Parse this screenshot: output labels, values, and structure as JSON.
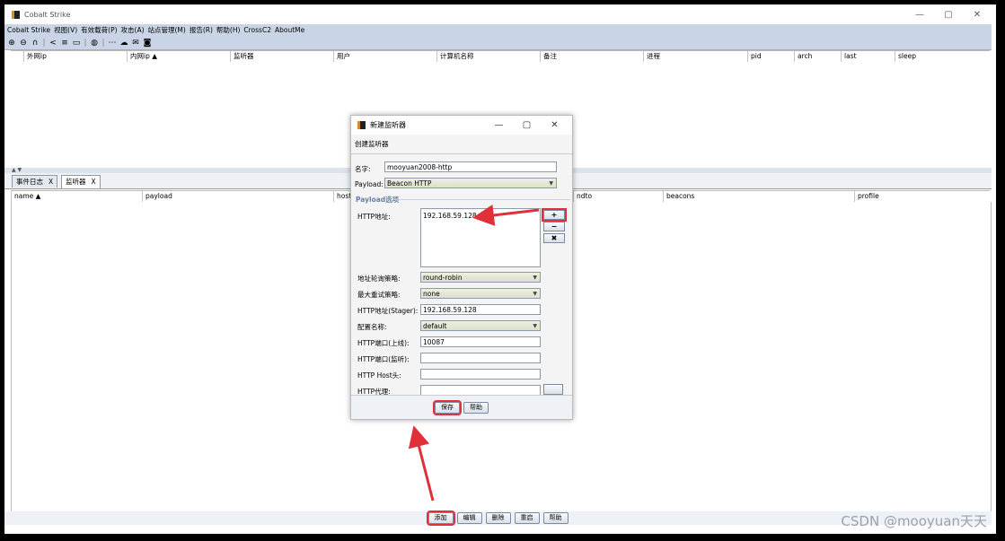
{
  "window": {
    "title": "Cobalt Strike",
    "min": "—",
    "max": "▢",
    "close": "✕"
  },
  "menu": [
    "Cobalt Strike",
    "视图(V)",
    "有效载荷(P)",
    "攻击(A)",
    "站点管理(M)",
    "报告(R)",
    "帮助(H)",
    "CrossC2",
    "AboutMe"
  ],
  "toolbar_icons": [
    "plus-circle-icon",
    "minus-circle-icon",
    "headphones-icon",
    "share-icon",
    "list-icon",
    "monitor-icon",
    "globe-icon",
    "ellipsis-icon",
    "cloud-icon",
    "mail-icon",
    "camera-icon"
  ],
  "session_table": {
    "columns": [
      "外网ip",
      "内网ip ▲",
      "监听器",
      "用户",
      "计算机名称",
      "备注",
      "进程",
      "pid",
      "arch",
      "last",
      "sleep"
    ]
  },
  "tabs": [
    {
      "label": "事件日志",
      "close": "X"
    },
    {
      "label": "监听器",
      "close": "X"
    }
  ],
  "listener_table": {
    "columns": [
      "name ▲",
      "payload",
      "host",
      "ndto",
      "beacons",
      "profile"
    ]
  },
  "bottom_buttons": [
    "添加",
    "编辑",
    "删除",
    "重启",
    "帮助"
  ],
  "dialog": {
    "title": "新建监听器",
    "subtitle": "创建监听器",
    "name_label": "名字:",
    "name_value": "mooyuan2008-http",
    "payload_label": "Payload:",
    "payload_value": "Beacon HTTP",
    "options_legend": "Payload选项",
    "http_hosts_label": "HTTP地址:",
    "http_hosts": [
      "192.168.59.128"
    ],
    "rotate_label": "地址轮询策略:",
    "rotate_value": "round-robin",
    "max_retry_label": "最大重试策略:",
    "max_retry_value": "none",
    "stager_label": "HTTP地址(Stager):",
    "stager_value": "192.168.59.128",
    "profile_label": "配置名称:",
    "profile_value": "default",
    "port_c2_label": "HTTP端口(上线):",
    "port_c2_value": "10087",
    "port_bind_label": "HTTP端口(监听):",
    "port_bind_value": "",
    "host_header_label": "HTTP Host头:",
    "host_header_value": "",
    "proxy_label": "HTTP代理:",
    "proxy_value": "",
    "side_add": "+",
    "side_remove": "−",
    "side_clear": "✖",
    "save": "保存",
    "help": "帮助"
  },
  "watermark": "CSDN @mooyuan天天",
  "colors": {
    "annotation": "#e0303a",
    "menubar": "#c9d5e7"
  }
}
